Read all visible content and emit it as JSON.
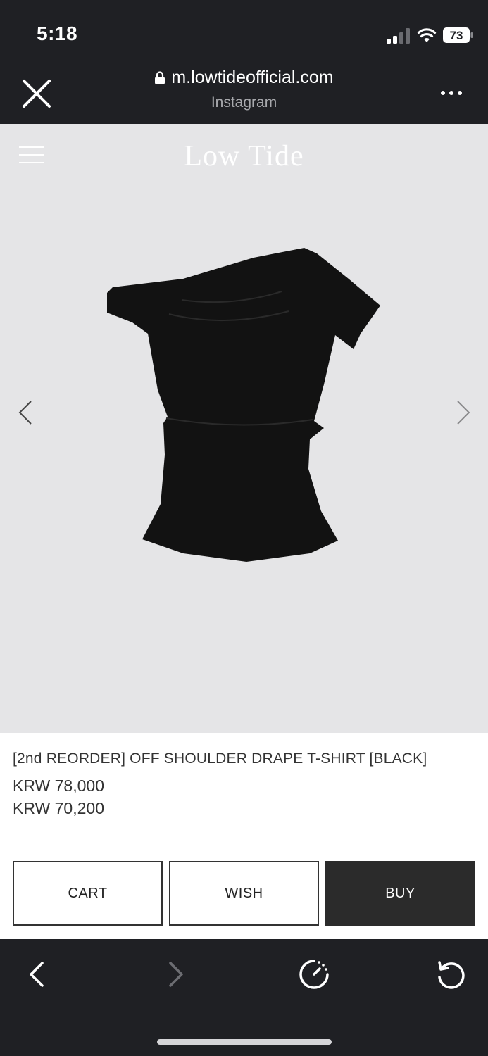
{
  "status_bar": {
    "time": "5:18",
    "battery": "73"
  },
  "browser": {
    "url": "m.lowtideofficial.com",
    "source": "Instagram"
  },
  "site": {
    "logo": "Low Tide"
  },
  "product": {
    "name": "[2nd REORDER] OFF SHOULDER DRAPE T-SHIRT [BLACK]",
    "price_original": "KRW 78,000",
    "price_sale": "KRW 70,200"
  },
  "actions": {
    "cart": "CART",
    "wish": "WISH",
    "buy": "BUY"
  },
  "icons": {
    "close": "close-icon",
    "lock": "lock-icon",
    "more": "more-icon",
    "menu": "hamburger-menu-icon",
    "prev": "chevron-left-icon",
    "next": "chevron-right-icon",
    "back": "back-icon",
    "forward": "forward-icon",
    "timer": "timer-icon",
    "reload": "reload-icon"
  },
  "colors": {
    "bar": "#1f2024",
    "hero_bg": "#e5e5e7",
    "buy_bg": "#2b2b2b"
  }
}
